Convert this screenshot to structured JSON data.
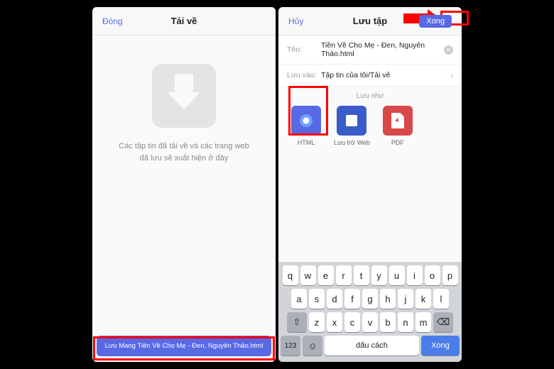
{
  "phone1": {
    "close": "Đóng",
    "title": "Tải về",
    "empty_l1": "Các tập tin đã tải về và các trang web",
    "empty_l2": "đã lưu sẽ xuất hiện ở đây",
    "download_btn": "Lưu Mang Tiền Về Cho Mẹ - Đen, Nguyên Thảo.html"
  },
  "phone2": {
    "cancel": "Hủy",
    "title": "Lưu tập",
    "done_btn": "Xong",
    "name_label": "Tên:",
    "name_value": "Tiền Về Cho Mẹ - Đen, Nguyên Thảo.html",
    "save_label": "Lưu vào:",
    "save_value": "Tập tin của tôi/Tải về",
    "saveas_label": "Lưu như",
    "formats": {
      "html": "HTML",
      "web": "Lưu trữ Web",
      "pdf": "PDF"
    },
    "keyboard": {
      "row1": [
        "q",
        "w",
        "e",
        "r",
        "t",
        "y",
        "u",
        "i",
        "o",
        "p"
      ],
      "row2": [
        "a",
        "s",
        "d",
        "f",
        "g",
        "h",
        "j",
        "k",
        "l"
      ],
      "row3": [
        "z",
        "x",
        "c",
        "v",
        "b",
        "n",
        "m"
      ],
      "shift": "⇧",
      "backspace": "⌫",
      "num": "123",
      "emoji": "☺",
      "space": "dấu cách",
      "done": "Xong"
    }
  }
}
